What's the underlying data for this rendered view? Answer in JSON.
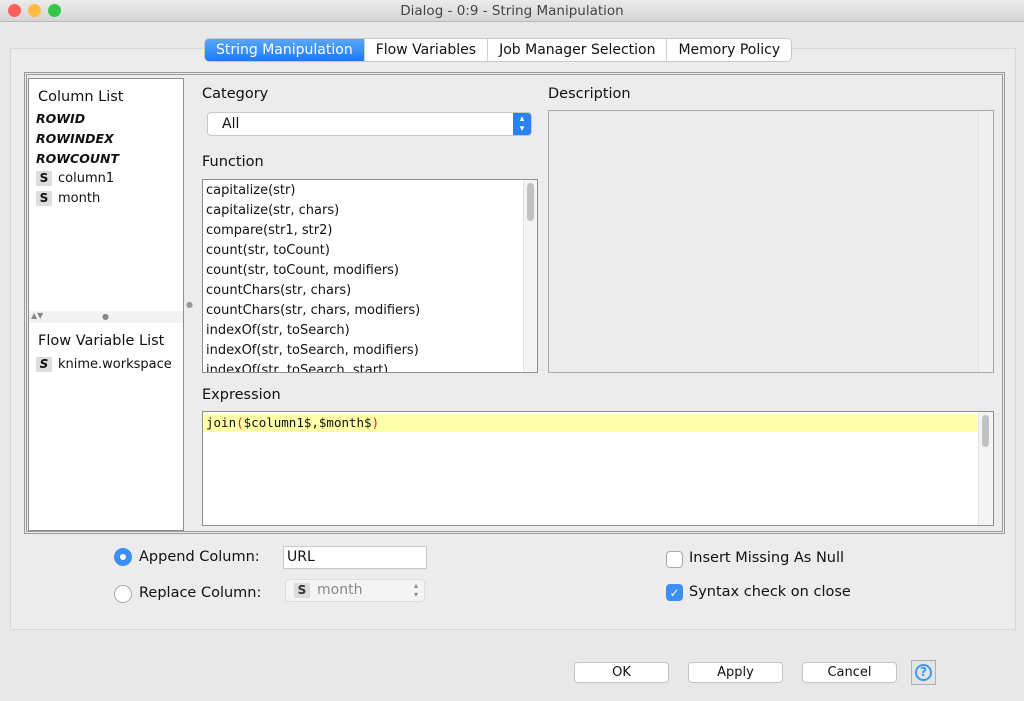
{
  "window": {
    "title": "Dialog - 0:9 - String Manipulation"
  },
  "tabs": [
    {
      "label": "String Manipulation",
      "active": true
    },
    {
      "label": "Flow Variables"
    },
    {
      "label": "Job Manager Selection"
    },
    {
      "label": "Memory Policy"
    }
  ],
  "column_list": {
    "title": "Column List",
    "special": [
      "ROWID",
      "ROWINDEX",
      "ROWCOUNT"
    ],
    "columns": [
      {
        "type": "S",
        "name": "column1"
      },
      {
        "type": "S",
        "name": "month"
      }
    ]
  },
  "flow_variable_list": {
    "title": "Flow Variable List",
    "items": [
      {
        "type": "S",
        "name": "knime.workspace"
      }
    ]
  },
  "category": {
    "label": "Category",
    "value": "All"
  },
  "function": {
    "label": "Function",
    "items": [
      "capitalize(str)",
      "capitalize(str, chars)",
      "compare(str1, str2)",
      "count(str, toCount)",
      "count(str, toCount, modifiers)",
      "countChars(str, chars)",
      "countChars(str, chars, modifiers)",
      "indexOf(str, toSearch)",
      "indexOf(str, toSearch, modifiers)",
      "indexOf(str, toSearch, start)"
    ]
  },
  "description": {
    "label": "Description"
  },
  "expression": {
    "label": "Expression",
    "fn": "join",
    "open": "(",
    "args": "$column1$,$month$",
    "close": ")",
    "highlight_color": "#ffffa8",
    "paren_color": "#e8201a"
  },
  "output": {
    "append_label": "Append Column:",
    "append_value": "URL",
    "append_selected": true,
    "replace_label": "Replace Column:",
    "replace_type": "S",
    "replace_value": "month",
    "replace_selected": false
  },
  "options": {
    "insert_missing_label": "Insert Missing As Null",
    "insert_missing_checked": false,
    "syntax_check_label": "Syntax check on close",
    "syntax_check_checked": true
  },
  "buttons": {
    "ok": "OK",
    "apply": "Apply",
    "cancel": "Cancel",
    "help": "?"
  },
  "colors": {
    "accent": "#1a7cf5"
  }
}
